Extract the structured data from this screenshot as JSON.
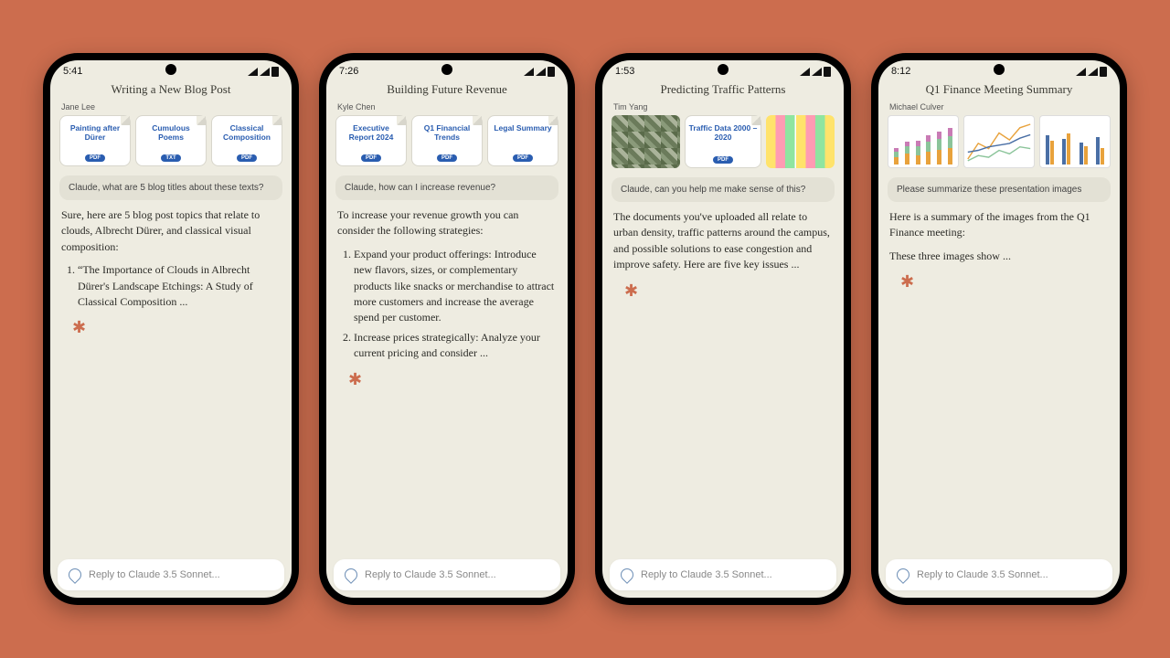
{
  "phones": [
    {
      "time": "5:41",
      "title": "Writing a New Blog Post",
      "author": "Jane Lee",
      "docs": [
        {
          "title": "Painting after Dürer",
          "badge": "PDF"
        },
        {
          "title": "Cumulous Poems",
          "badge": "TXT"
        },
        {
          "title": "Classical Composition",
          "badge": "PDF"
        }
      ],
      "prompt": "Claude, what are 5 blog titles about these texts?",
      "response_intro": "Sure, here are 5 blog post topics that relate to clouds, Albrecht Dürer, and classical visual composition:",
      "response_item1": "“The Importance of Clouds in Albrecht Dürer's Landscape Etchings: A Study of Classical Composition ...",
      "input_placeholder": "Reply to Claude 3.5 Sonnet..."
    },
    {
      "time": "7:26",
      "title": "Building Future Revenue",
      "author": "Kyle Chen",
      "docs": [
        {
          "title": "Executive Report 2024",
          "badge": "PDF"
        },
        {
          "title": "Q1 Financial Trends",
          "badge": "PDF"
        },
        {
          "title": "Legal Summary",
          "badge": "PDF"
        }
      ],
      "prompt": "Claude, how can I increase revenue?",
      "response_intro": "To increase your revenue growth you can consider the following strategies:",
      "response_item1": "Expand your product offerings: Introduce new flavors, sizes, or complementary products like snacks or merchandise to attract more customers and increase the average spend per customer.",
      "response_item2": "Increase prices strategically: Analyze your current pricing and consider ...",
      "input_placeholder": "Reply to Claude 3.5 Sonnet..."
    },
    {
      "time": "1:53",
      "title": "Predicting Traffic Patterns",
      "author": "Tim Yang",
      "doc_center": {
        "title": "Traffic Data 2000 – 2020",
        "badge": "PDF"
      },
      "prompt": "Claude, can you help me make sense of this?",
      "response_intro": "The documents you've uploaded all relate to urban density, traffic patterns around the campus, and possible solutions to ease congestion and improve safety. Here are five key issues ...",
      "input_placeholder": "Reply to Claude 3.5 Sonnet..."
    },
    {
      "time": "8:12",
      "title": "Q1 Finance Meeting Summary",
      "author": "Michael Culver",
      "prompt": "Please summarize these presentation images",
      "response_intro": "Here is a summary of the images from the Q1 Finance meeting:",
      "response_p2": "These three images show ...",
      "input_placeholder": "Reply to Claude 3.5 Sonnet..."
    }
  ]
}
